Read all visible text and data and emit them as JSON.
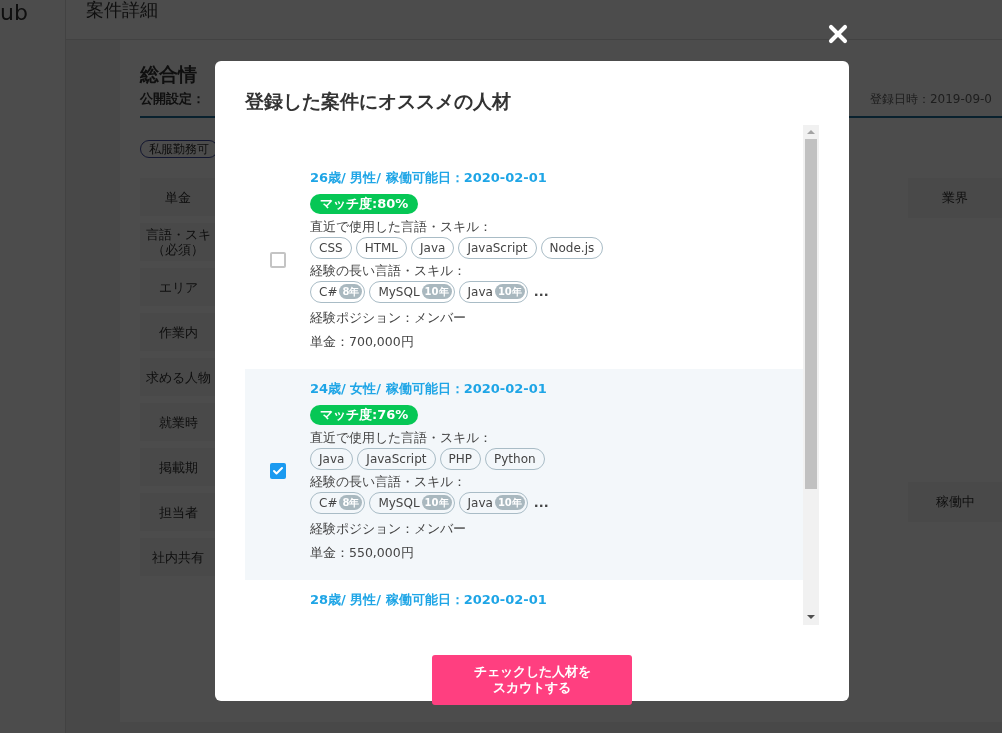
{
  "background": {
    "logo_text": "ub",
    "page_title": "案件詳細",
    "section_title": "総合情",
    "publish_label": "公開設定：",
    "registered": "登録日時：2019-09-0",
    "tag": "私服勤務可",
    "labels": [
      [
        "単金"
      ],
      [
        "言語・スキ",
        "（必須）"
      ],
      [
        "エリア"
      ],
      [
        "作業内"
      ],
      [
        "求める人物"
      ],
      [
        "就業時"
      ],
      [
        "掲載期"
      ],
      [
        "担当者"
      ],
      [
        "社内共有"
      ]
    ],
    "right_cells": [
      "業界",
      "稼働中"
    ]
  },
  "modal": {
    "title": "登録した案件にオススメの人材",
    "candidates": [
      {
        "selected": false,
        "profile": "26歳/ 男性/ 稼働可能日：2020-02-01",
        "match": "マッチ度:80%",
        "recent_label": "直近で使用した言語・スキル：",
        "recent_skills": [
          "CSS",
          "HTML",
          "Java",
          "JavaScript",
          "Node.js"
        ],
        "long_label": "経験の長い言語・スキル：",
        "long_skills": [
          {
            "name": "C#",
            "years": "8年"
          },
          {
            "name": "MySQL",
            "years": "10年"
          },
          {
            "name": "Java",
            "years": "10年"
          }
        ],
        "more": "...",
        "position": "経験ポジション：メンバー",
        "rate": "単金：700,000円"
      },
      {
        "selected": true,
        "profile": "24歳/ 女性/ 稼働可能日：2020-02-01",
        "match": "マッチ度:76%",
        "recent_label": "直近で使用した言語・スキル：",
        "recent_skills": [
          "Java",
          "JavaScript",
          "PHP",
          "Python"
        ],
        "long_label": "経験の長い言語・スキル：",
        "long_skills": [
          {
            "name": "C#",
            "years": "8年"
          },
          {
            "name": "MySQL",
            "years": "10年"
          },
          {
            "name": "Java",
            "years": "10年"
          }
        ],
        "more": "...",
        "position": "経験ポジション：メンバー",
        "rate": "単金：550,000円"
      },
      {
        "profile": "28歳/ 男性/ 稼働可能日：2020-02-01"
      }
    ],
    "scout_button": [
      "チェックした人材を",
      "スカウトする"
    ]
  }
}
